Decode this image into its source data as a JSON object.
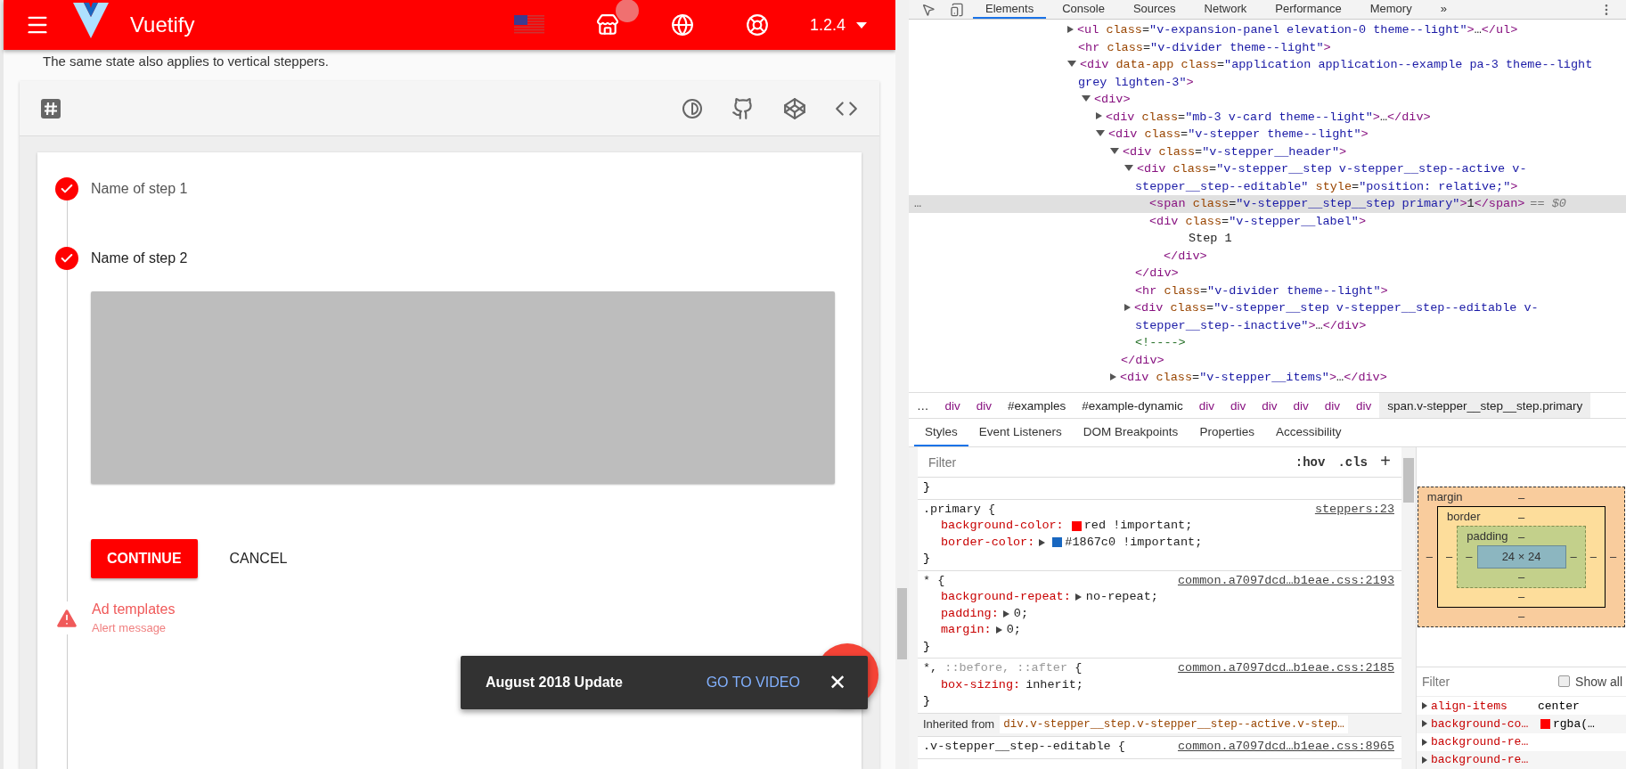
{
  "header": {
    "title": "Vuetify",
    "version": "1.2.4"
  },
  "intro_text": "The same state also applies to vertical steppers.",
  "steps": [
    {
      "kind": "complete",
      "label": "Name of step 1",
      "selected": false
    },
    {
      "kind": "complete",
      "label": "Name of step 2",
      "selected": true
    }
  ],
  "actions": [
    {
      "kind": "raised",
      "label": "CONTINUE"
    },
    {
      "kind": "flat",
      "label": "CANCEL"
    }
  ],
  "error_step": {
    "kind": "error",
    "label": "Ad templates",
    "sublabel": "Alert message"
  },
  "snackbar": {
    "text": "August 2018 Update",
    "action": "GO TO VIDEO",
    "close": "✕"
  },
  "devtools": {
    "tabs": [
      {
        "label": "Elements",
        "selected": true
      },
      {
        "label": "Console",
        "selected": false
      },
      {
        "label": "Sources",
        "selected": false
      },
      {
        "label": "Network",
        "selected": false
      },
      {
        "label": "Performance",
        "selected": false
      },
      {
        "label": "Memory",
        "selected": false
      }
    ],
    "more_tabs": "»",
    "dom_tree": [
      {
        "kind": "element",
        "markup": "<ul class=\"v-expansion-panel elevation-0 theme--light\">…</ul>",
        "expanded": false,
        "selected": false
      },
      {
        "kind": "leaf",
        "markup": "<hr class=\"v-divider theme--light\">",
        "selected": false
      },
      {
        "kind": "element",
        "markup": "<div data-app class=\"application application--example pa-3 theme--light grey lighten-3\">",
        "expanded": true,
        "selected": false,
        "children": [
          {
            "kind": "element",
            "markup": "<div>",
            "expanded": true,
            "selected": false,
            "children": [
              {
                "kind": "element",
                "markup": "<div class=\"mb-3 v-card theme--light\">…</div>",
                "expanded": false,
                "selected": false
              },
              {
                "kind": "element",
                "markup": "<div class=\"v-stepper theme--light\">",
                "expanded": true,
                "selected": false,
                "children": [
                  {
                    "kind": "element",
                    "markup": "<div class=\"v-stepper__header\">",
                    "expanded": true,
                    "selected": false,
                    "close": "</div>",
                    "children": [
                      {
                        "kind": "element",
                        "markup": "<div class=\"v-stepper__step v-stepper__step--active v-stepper__step--editable\" style=\"position: relative;\">",
                        "expanded": true,
                        "selected": false,
                        "close": "</div>",
                        "children": [
                          {
                            "kind": "leaf",
                            "markup": "<span class=\"v-stepper__step__step primary\">1</span>",
                            "selected": true,
                            "marker": "== $0",
                            "dots": "…"
                          },
                          {
                            "kind": "leaf",
                            "markup": "<div class=\"v-stepper__label\">",
                            "selected": false,
                            "close": "</div>",
                            "children": [
                              {
                                "kind": "text",
                                "markup": "Step 1",
                                "selected": false
                              }
                            ]
                          }
                        ]
                      },
                      {
                        "kind": "leaf",
                        "markup": "<hr class=\"v-divider theme--light\">",
                        "selected": false
                      },
                      {
                        "kind": "element",
                        "markup": "<div class=\"v-stepper__step v-stepper__step--editable v-stepper__step--inactive\">…</div>",
                        "expanded": false,
                        "selected": false
                      },
                      {
                        "kind": "comment",
                        "markup": "<!---->",
                        "selected": false
                      }
                    ]
                  },
                  {
                    "kind": "element",
                    "markup": "<div class=\"v-stepper__items\">…</div>",
                    "expanded": false,
                    "selected": false
                  }
                ]
              }
            ]
          }
        ]
      }
    ],
    "breadcrumb": [
      {
        "label": "…",
        "selected": false
      },
      {
        "label": "div",
        "selected": false
      },
      {
        "label": "div",
        "selected": false
      },
      {
        "label": "#examples",
        "selected": false
      },
      {
        "label": "#example-dynamic",
        "selected": false
      },
      {
        "label": "div",
        "selected": false
      },
      {
        "label": "div",
        "selected": false
      },
      {
        "label": "div",
        "selected": false
      },
      {
        "label": "div",
        "selected": false
      },
      {
        "label": "div",
        "selected": false
      },
      {
        "label": "div",
        "selected": false
      },
      {
        "label": "span.v-stepper__step__step.primary",
        "selected": true
      }
    ],
    "pane_tabs": [
      {
        "label": "Styles",
        "selected": true
      },
      {
        "label": "Event Listeners",
        "selected": false
      },
      {
        "label": "DOM Breakpoints",
        "selected": false
      },
      {
        "label": "Properties",
        "selected": false
      },
      {
        "label": "Accessibility",
        "selected": false
      }
    ],
    "styles_filter": {
      "placeholder": "Filter",
      "hov": ":hov",
      "cls": ".cls",
      "add": "+"
    },
    "rules": [
      {
        "kind": "tail",
        "close": "}"
      },
      {
        "kind": "rule",
        "selector": [
          {
            "text": ".primary {",
            "dim": false
          }
        ],
        "source": "steppers:23",
        "props": [
          {
            "name": "background-color:",
            "value": "red !important;",
            "expander": false,
            "color": "#ff0000"
          },
          {
            "name": "border-color:",
            "value": "#1867c0 !important;",
            "expander": true,
            "color": "#1867c0"
          }
        ],
        "close": "}"
      },
      {
        "kind": "rule",
        "selector": [
          {
            "text": "* {",
            "dim": false
          }
        ],
        "source": "common.a7097dcd…b1eae.css:2193",
        "props": [
          {
            "name": "background-repeat:",
            "value": "no-repeat;",
            "expander": true
          },
          {
            "name": "padding:",
            "value": "0;",
            "expander": true
          },
          {
            "name": "margin:",
            "value": "0;",
            "expander": true
          }
        ],
        "close": "}"
      },
      {
        "kind": "rule",
        "selector": [
          {
            "text": "*, ",
            "dim": false
          },
          {
            "text": "::before, ::after",
            "dim": true
          },
          {
            "text": " {",
            "dim": false
          }
        ],
        "source": "common.a7097dcd…b1eae.css:2185",
        "props": [
          {
            "name": "box-sizing:",
            "value": "inherit;",
            "expander": false
          }
        ],
        "close": "}"
      },
      {
        "kind": "inherited",
        "label": "Inherited from",
        "selector": "div.v-stepper__step.v-stepper__step--active.v-step…"
      },
      {
        "kind": "rule",
        "selector": [
          {
            "text": ".v-stepper__step--editable {",
            "dim": false
          }
        ],
        "source": "common.a7097dcd…b1eae.css:8965"
      }
    ],
    "box_model": {
      "margin": {
        "label": "margin",
        "top": "–",
        "right": "–",
        "bottom": "–",
        "left": "–"
      },
      "border": {
        "label": "border",
        "top": "–",
        "right": "–",
        "bottom": "–",
        "left": "–"
      },
      "padding": {
        "label": "padding",
        "top": "–",
        "right": "–",
        "bottom": "–",
        "left": "–"
      },
      "content": "24 × 24"
    },
    "computed": {
      "placeholder": "Filter",
      "show_all": {
        "label": "Show all",
        "checked": false
      },
      "props": [
        {
          "name": "align-items",
          "value": "center"
        },
        {
          "name": "background-co…",
          "value": "rgba(…",
          "color": "#ff0000"
        },
        {
          "name": "background-re…"
        },
        {
          "name": "background-re…"
        }
      ]
    }
  }
}
